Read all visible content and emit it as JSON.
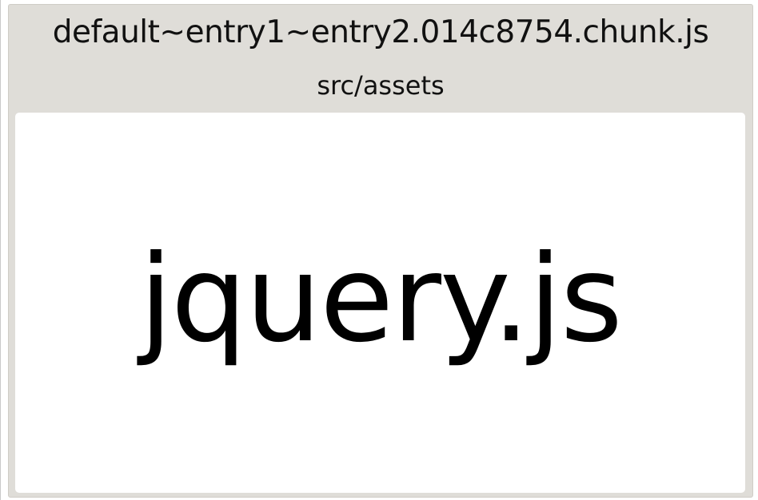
{
  "chunk": {
    "title": "default~entry1~entry2.014c8754.chunk.js"
  },
  "folder": {
    "title": "src/assets"
  },
  "file": {
    "label": "jquery.js"
  }
}
